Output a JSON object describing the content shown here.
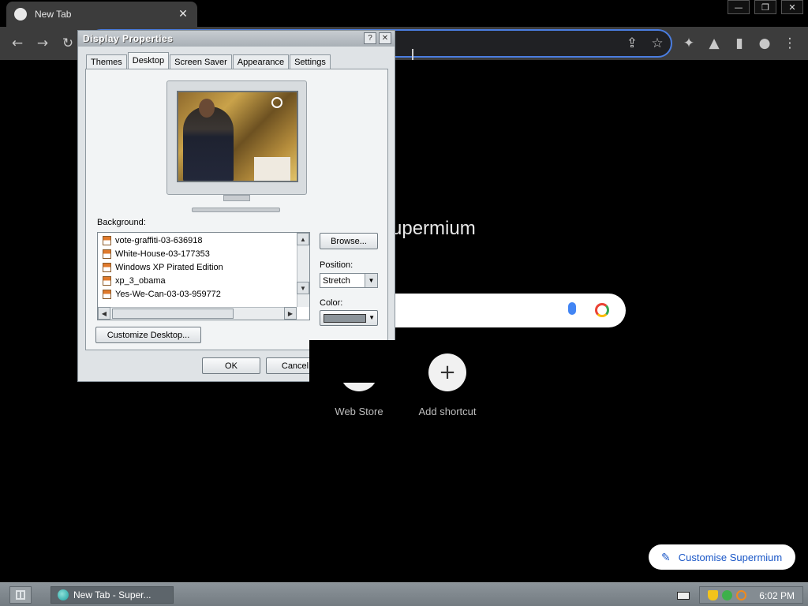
{
  "browser": {
    "tab_title": "New Tab",
    "brand_text": "Supermium",
    "shortcuts": [
      {
        "label": "Web Store"
      },
      {
        "label": "Add shortcut",
        "icon": "+"
      }
    ],
    "customise_label": "Customise Supermium"
  },
  "dialog": {
    "title": "Display Properties",
    "tabs": [
      "Themes",
      "Desktop",
      "Screen Saver",
      "Appearance",
      "Settings"
    ],
    "active_tab": "Desktop",
    "background_label": "Background:",
    "background_items": [
      "vote-graffiti-03-636918",
      "White-House-03-177353",
      "Windows XP Pirated Edition",
      "xp_3_obama",
      "Yes-We-Can-03-03-959772"
    ],
    "browse_label": "Browse...",
    "position_label": "Position:",
    "position_value": "Stretch",
    "color_label": "Color:",
    "color_value": "#8c949a",
    "customize_label": "Customize Desktop...",
    "ok_label": "OK",
    "cancel_label": "Cancel"
  },
  "taskbar": {
    "task_label": "New Tab - Super...",
    "clock": "6:02 PM"
  }
}
